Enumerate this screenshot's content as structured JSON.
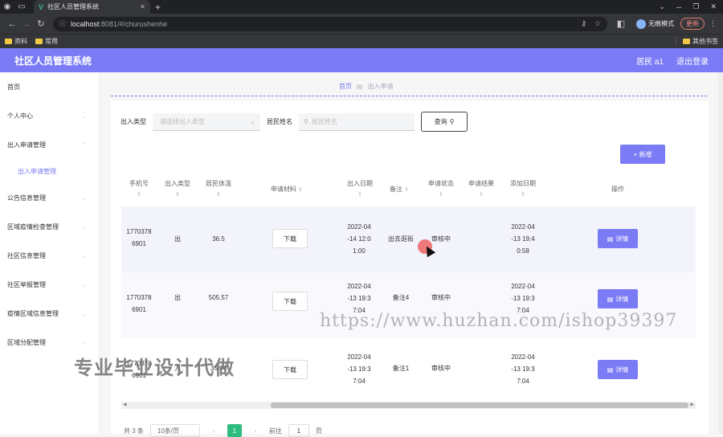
{
  "browser": {
    "tab_title": "社区人员管理系统",
    "url_host": "localhost",
    "url_path": ":8081/#/churushenhe",
    "incognito_label": "无痕模式",
    "update_label": "更新",
    "bookmarks": [
      "资料",
      "常用"
    ],
    "other_bookmarks": "其他书签"
  },
  "app": {
    "title": "社区人员管理系统",
    "user": "居民 a1",
    "logout": "退出登录"
  },
  "sidebar": {
    "items": [
      {
        "label": "首页"
      },
      {
        "label": "个人中心"
      },
      {
        "label": "出入申请管理"
      },
      {
        "label": "公告信息管理"
      },
      {
        "label": "区域疫情检查管理"
      },
      {
        "label": "社区信息管理"
      },
      {
        "label": "社区举报管理"
      },
      {
        "label": "疫情区域信息管理"
      },
      {
        "label": "区域分配管理"
      }
    ],
    "sub_active": "出入申请管理"
  },
  "breadcrumb": {
    "home": "首页",
    "current": "出入申请"
  },
  "filter": {
    "type_label": "出入类型",
    "type_placeholder": "请选择出入类型",
    "name_label": "居民姓名",
    "name_placeholder": "居民姓名",
    "query_label": "查询"
  },
  "add_label": "+ 新增",
  "table": {
    "headers": [
      "手机号",
      "出入类型",
      "居民体温",
      "申请材料",
      "出入日期",
      "备注",
      "申请状态",
      "申请结果",
      "添加日期",
      "操作"
    ],
    "download_label": "下载",
    "detail_label": "详情",
    "rows": [
      {
        "phone": [
          "1770378",
          "6901"
        ],
        "type": "出",
        "temp": "36.5",
        "date": [
          "2022-04",
          "-14 12:0",
          "1:00"
        ],
        "note": "出去逛街",
        "status": "审核中",
        "result": "",
        "added": [
          "2022-04",
          "-13 19:4",
          "0:58"
        ]
      },
      {
        "phone": [
          "1770378",
          "6901"
        ],
        "type": "出",
        "temp": "505.57",
        "date": [
          "2022-04",
          "-13 19:3",
          "7:04"
        ],
        "note": "备注4",
        "status": "审核中",
        "result": "",
        "added": [
          "2022-04",
          "-13 19:3",
          "7:04"
        ]
      },
      {
        "phone": [
          "1770378",
          "6901"
        ],
        "type": "入",
        "temp": "35.04",
        "date": [
          "2022-04",
          "-13 19:3",
          "7:04"
        ],
        "note": "备注1",
        "status": "审核中",
        "result": "",
        "added": [
          "2022-04",
          "-13 19:3",
          "7:04"
        ]
      }
    ]
  },
  "pager": {
    "total": "共 3 条",
    "page_size": "10条/页",
    "current": "1",
    "goto_label": "前往",
    "goto_value": "1",
    "page_suffix": "页"
  },
  "overlays": {
    "watermark": "https://www.huzhan.com/ishop39397",
    "promo": "专业毕业设计代做"
  }
}
